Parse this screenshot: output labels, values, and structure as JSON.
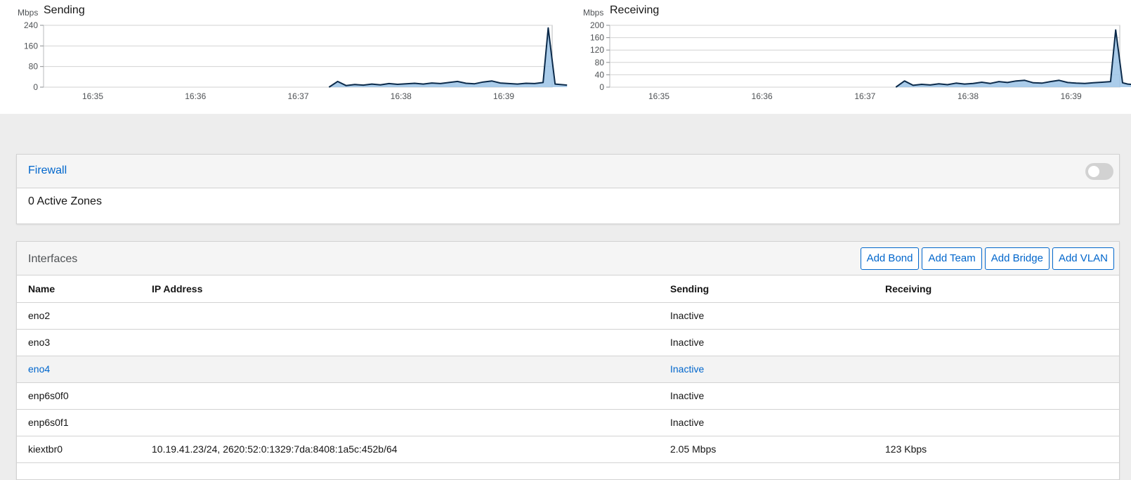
{
  "graphs": [
    {
      "id": "sending",
      "unit": "Mbps",
      "title": "Sending",
      "y_ticks": [
        "240",
        "160",
        "80",
        "0"
      ],
      "x_ticks": [
        "16:35",
        "16:36",
        "16:37",
        "16:38",
        "16:39"
      ]
    },
    {
      "id": "receiving",
      "unit": "Mbps",
      "title": "Receiving",
      "y_ticks": [
        "200",
        "160",
        "120",
        "80",
        "40",
        "0"
      ],
      "x_ticks": [
        "16:35",
        "16:36",
        "16:37",
        "16:38",
        "16:39"
      ]
    }
  ],
  "chart_data": [
    {
      "type": "area",
      "title": "Sending",
      "ylabel": "Mbps",
      "ylim": [
        0,
        240
      ],
      "x_ticks": [
        "16:35",
        "16:36",
        "16:37",
        "16:38",
        "16:39"
      ],
      "x": [
        "16:37:18",
        "16:37:23",
        "16:37:28",
        "16:37:33",
        "16:37:38",
        "16:37:43",
        "16:37:48",
        "16:37:53",
        "16:37:58",
        "16:38:03",
        "16:38:08",
        "16:38:13",
        "16:38:18",
        "16:38:23",
        "16:38:28",
        "16:38:33",
        "16:38:38",
        "16:38:43",
        "16:38:48",
        "16:38:53",
        "16:38:58",
        "16:39:03",
        "16:39:08",
        "16:39:13",
        "16:39:18",
        "16:39:23",
        "16:39:26",
        "16:39:28",
        "16:39:30",
        "16:39:33",
        "16:39:37"
      ],
      "values": [
        0,
        22,
        6,
        10,
        8,
        12,
        9,
        14,
        11,
        13,
        15,
        12,
        16,
        14,
        18,
        22,
        15,
        13,
        20,
        24,
        16,
        14,
        12,
        15,
        14,
        18,
        230,
        120,
        12,
        10,
        8
      ]
    },
    {
      "type": "area",
      "title": "Receiving",
      "ylabel": "Mbps",
      "ylim": [
        0,
        200
      ],
      "x_ticks": [
        "16:35",
        "16:36",
        "16:37",
        "16:38",
        "16:39"
      ],
      "x": [
        "16:37:18",
        "16:37:23",
        "16:37:28",
        "16:37:33",
        "16:37:38",
        "16:37:43",
        "16:37:48",
        "16:37:53",
        "16:37:58",
        "16:38:03",
        "16:38:08",
        "16:38:13",
        "16:38:18",
        "16:38:23",
        "16:38:28",
        "16:38:33",
        "16:38:38",
        "16:38:43",
        "16:38:48",
        "16:38:53",
        "16:38:58",
        "16:39:03",
        "16:39:08",
        "16:39:13",
        "16:39:18",
        "16:39:23",
        "16:39:26",
        "16:39:28",
        "16:39:30",
        "16:39:33",
        "16:39:37"
      ],
      "values": [
        0,
        20,
        6,
        9,
        7,
        11,
        8,
        13,
        10,
        12,
        16,
        12,
        18,
        15,
        20,
        22,
        14,
        13,
        18,
        22,
        15,
        13,
        12,
        14,
        16,
        18,
        185,
        100,
        14,
        10,
        8
      ]
    }
  ],
  "firewall": {
    "title": "Firewall",
    "zones": "0 Active Zones",
    "enabled": false
  },
  "interfaces": {
    "title": "Interfaces",
    "buttons": [
      "Add Bond",
      "Add Team",
      "Add Bridge",
      "Add VLAN"
    ],
    "columns": [
      "Name",
      "IP Address",
      "Sending",
      "Receiving"
    ],
    "rows": [
      {
        "name": "eno2",
        "ip": "",
        "sending": "Inactive",
        "receiving": ""
      },
      {
        "name": "eno3",
        "ip": "",
        "sending": "Inactive",
        "receiving": ""
      },
      {
        "name": "eno4",
        "ip": "",
        "sending": "Inactive",
        "receiving": ""
      },
      {
        "name": "enp6s0f0",
        "ip": "",
        "sending": "Inactive",
        "receiving": ""
      },
      {
        "name": "enp6s0f1",
        "ip": "",
        "sending": "Inactive",
        "receiving": ""
      },
      {
        "name": "kiextbr0",
        "ip": "10.19.41.23/24, 2620:52:0:1329:7da:8408:1a5c:452b/64",
        "sending": "2.05 Mbps",
        "receiving": "123 Kbps"
      }
    ]
  },
  "colors": {
    "link": "#0066cc",
    "graph_line": "#0b2a4a",
    "graph_fill": "#9bc3e6"
  }
}
